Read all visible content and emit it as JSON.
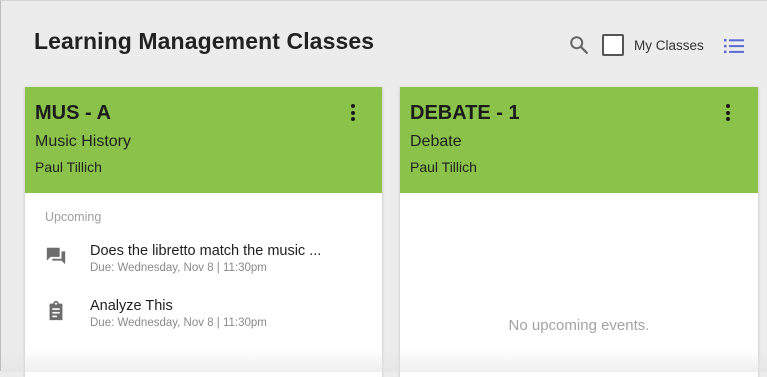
{
  "header": {
    "title": "Learning Management Classes",
    "filter_label": "My Classes",
    "icons": [
      "search-icon",
      "checkbox-icon",
      "list-view-icon"
    ]
  },
  "cards": [
    {
      "code": "MUS - A",
      "name": "Music History",
      "instructor": "Paul Tillich",
      "color": "#8bc34a",
      "upcoming_label": "Upcoming",
      "events": [
        {
          "icon": "discussion-icon",
          "title": "Does the libretto match the music ...",
          "due": "Due: Wednesday, Nov 8 | 11:30pm"
        },
        {
          "icon": "assignment-icon",
          "title": "Analyze This",
          "due": "Due: Wednesday, Nov 8 | 11:30pm"
        }
      ]
    },
    {
      "code": "DEBATE - 1",
      "name": "Debate",
      "instructor": "Paul Tillich",
      "color": "#8bc34a",
      "empty_message": "No upcoming events."
    }
  ]
}
